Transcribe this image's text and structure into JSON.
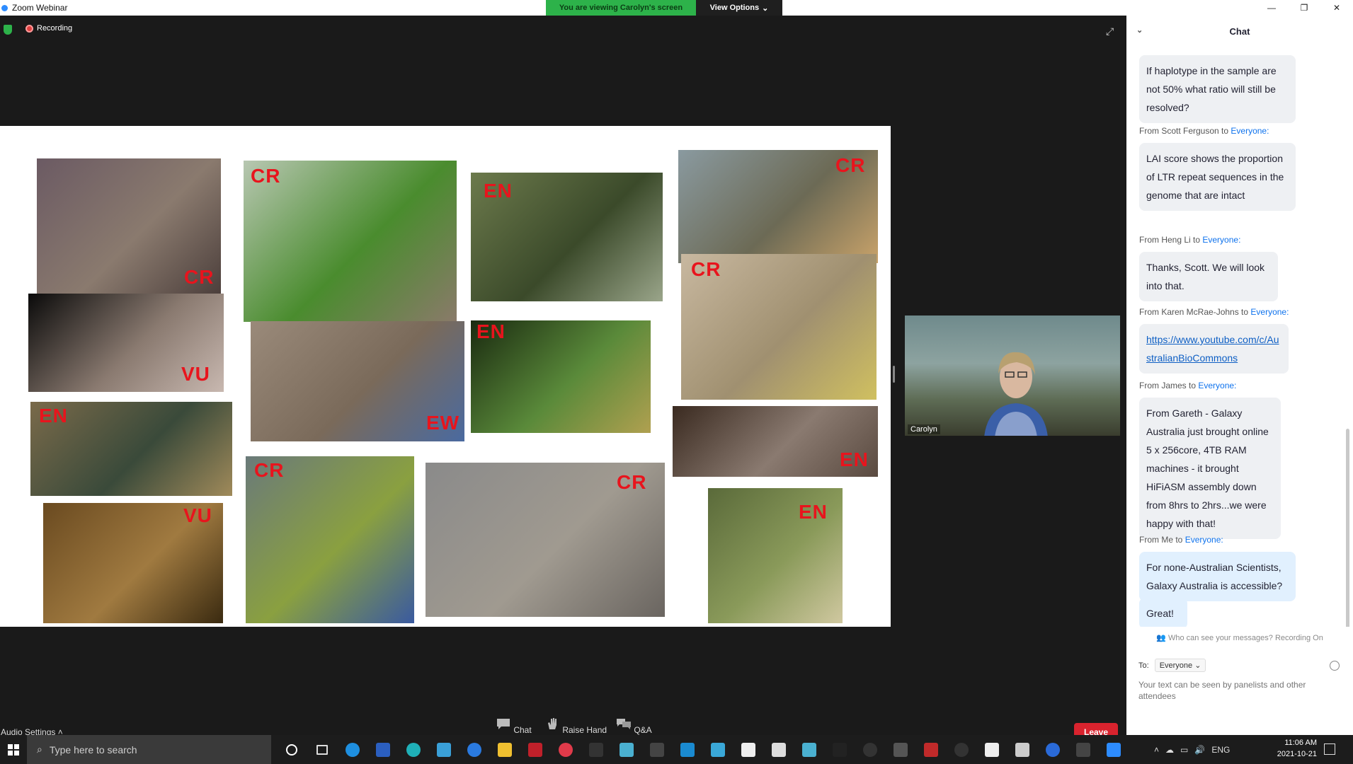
{
  "window": {
    "title": "Zoom Webinar",
    "viewing_banner": "You are viewing Carolyn's screen",
    "view_options": "View Options"
  },
  "meeting": {
    "recording_label": "Recording",
    "video_name": "Carolyn",
    "audio_settings": "Audio Settings",
    "chat_button": "Chat",
    "raise_hand_button": "Raise Hand",
    "qa_button": "Q&A",
    "leave_button": "Leave"
  },
  "slide": {
    "photos": [
      {
        "name": "frog-dark",
        "tag": "CR",
        "colors": [
          "#6b5a63",
          "#8a7a6e",
          "#4a3d3a"
        ]
      },
      {
        "name": "swift-parrot",
        "tag": "CR",
        "colors": [
          "#b8c7b2",
          "#4a8c2e",
          "#8a7a6a"
        ]
      },
      {
        "name": "rainforest",
        "tag": "EN",
        "colors": [
          "#6c7a4c",
          "#3b4a2a",
          "#9aa58a"
        ]
      },
      {
        "name": "turtle",
        "tag": "CR",
        "colors": [
          "#8a9aa0",
          "#6c6a55",
          "#c9a36a"
        ]
      },
      {
        "name": "bat",
        "tag": "VU",
        "colors": [
          "#0a0a0a",
          "#8a7a70",
          "#c8b8b0"
        ]
      },
      {
        "name": "skink",
        "tag": "EW",
        "colors": [
          "#9a8a7a",
          "#7a6a5a",
          "#4a6aa0"
        ]
      },
      {
        "name": "green-frog",
        "tag": "EN",
        "colors": [
          "#1a2a10",
          "#5a8a3a",
          "#b0a050"
        ]
      },
      {
        "name": "pardalote",
        "tag": "CR",
        "colors": [
          "#c8b8a0",
          "#a09070",
          "#d0c060"
        ]
      },
      {
        "name": "crayfish",
        "tag": "EN",
        "colors": [
          "#7a6a4a",
          "#3a4a3a",
          "#a08a5a"
        ]
      },
      {
        "name": "fish",
        "tag": "EN",
        "colors": [
          "#3a2a20",
          "#8a7a70",
          "#5a4a40"
        ]
      },
      {
        "name": "brown-frog",
        "tag": "VU",
        "colors": [
          "#6a4a20",
          "#a07a40",
          "#3a2a10"
        ]
      },
      {
        "name": "orange-bellied-parrot",
        "tag": "CR",
        "colors": [
          "#6a7a7a",
          "#8aa040",
          "#3a5aa0"
        ]
      },
      {
        "name": "sawfish",
        "tag": "CR",
        "colors": [
          "#8a8a8a",
          "#a09a90",
          "#6a6560"
        ]
      },
      {
        "name": "plant",
        "tag": "EN",
        "colors": [
          "#5a6a3a",
          "#8a9a5a",
          "#d0c8a0"
        ]
      }
    ]
  },
  "chat": {
    "header": "Chat",
    "messages": [
      {
        "from": "",
        "to": "",
        "text": "If haplotype in the sample are not 50% what ratio will still be resolved?"
      },
      {
        "from": "From Scott Ferguson to ",
        "to": "Everyone:",
        "text": "LAI score shows the proportion of LTR repeat sequences in the genome that are intact"
      },
      {
        "from": "From Heng Li to ",
        "to": "Everyone:",
        "text": "Thanks, Scott. We will look into that."
      },
      {
        "from": "From Karen McRae-Johns to ",
        "to": "Everyone:",
        "link": "https://www.youtube.com/c/AustralianBioCommons"
      },
      {
        "from": "From James to ",
        "to": "Everyone:",
        "text": "From Gareth - Galaxy Australia just brought online 5 x 256core, 4TB RAM machines - it brought HiFiASM assembly down from 8hrs to 2hrs...we were happy with that!"
      },
      {
        "from": "From Me to ",
        "to": "Everyone:",
        "text": "For none-Australian Scientists, Galaxy Australia is accessible?"
      },
      {
        "from": "",
        "to": "",
        "text": "Great!"
      }
    ],
    "who_can_see": "Who can see your messages? Recording On",
    "to_label": "To:",
    "to_value": "Everyone",
    "input_placeholder": "Your text can be seen by panelists and other attendees"
  },
  "taskbar": {
    "search_placeholder": "Type here to search",
    "lang": "ENG",
    "time": "11:06 AM",
    "date": "2021-10-21"
  }
}
